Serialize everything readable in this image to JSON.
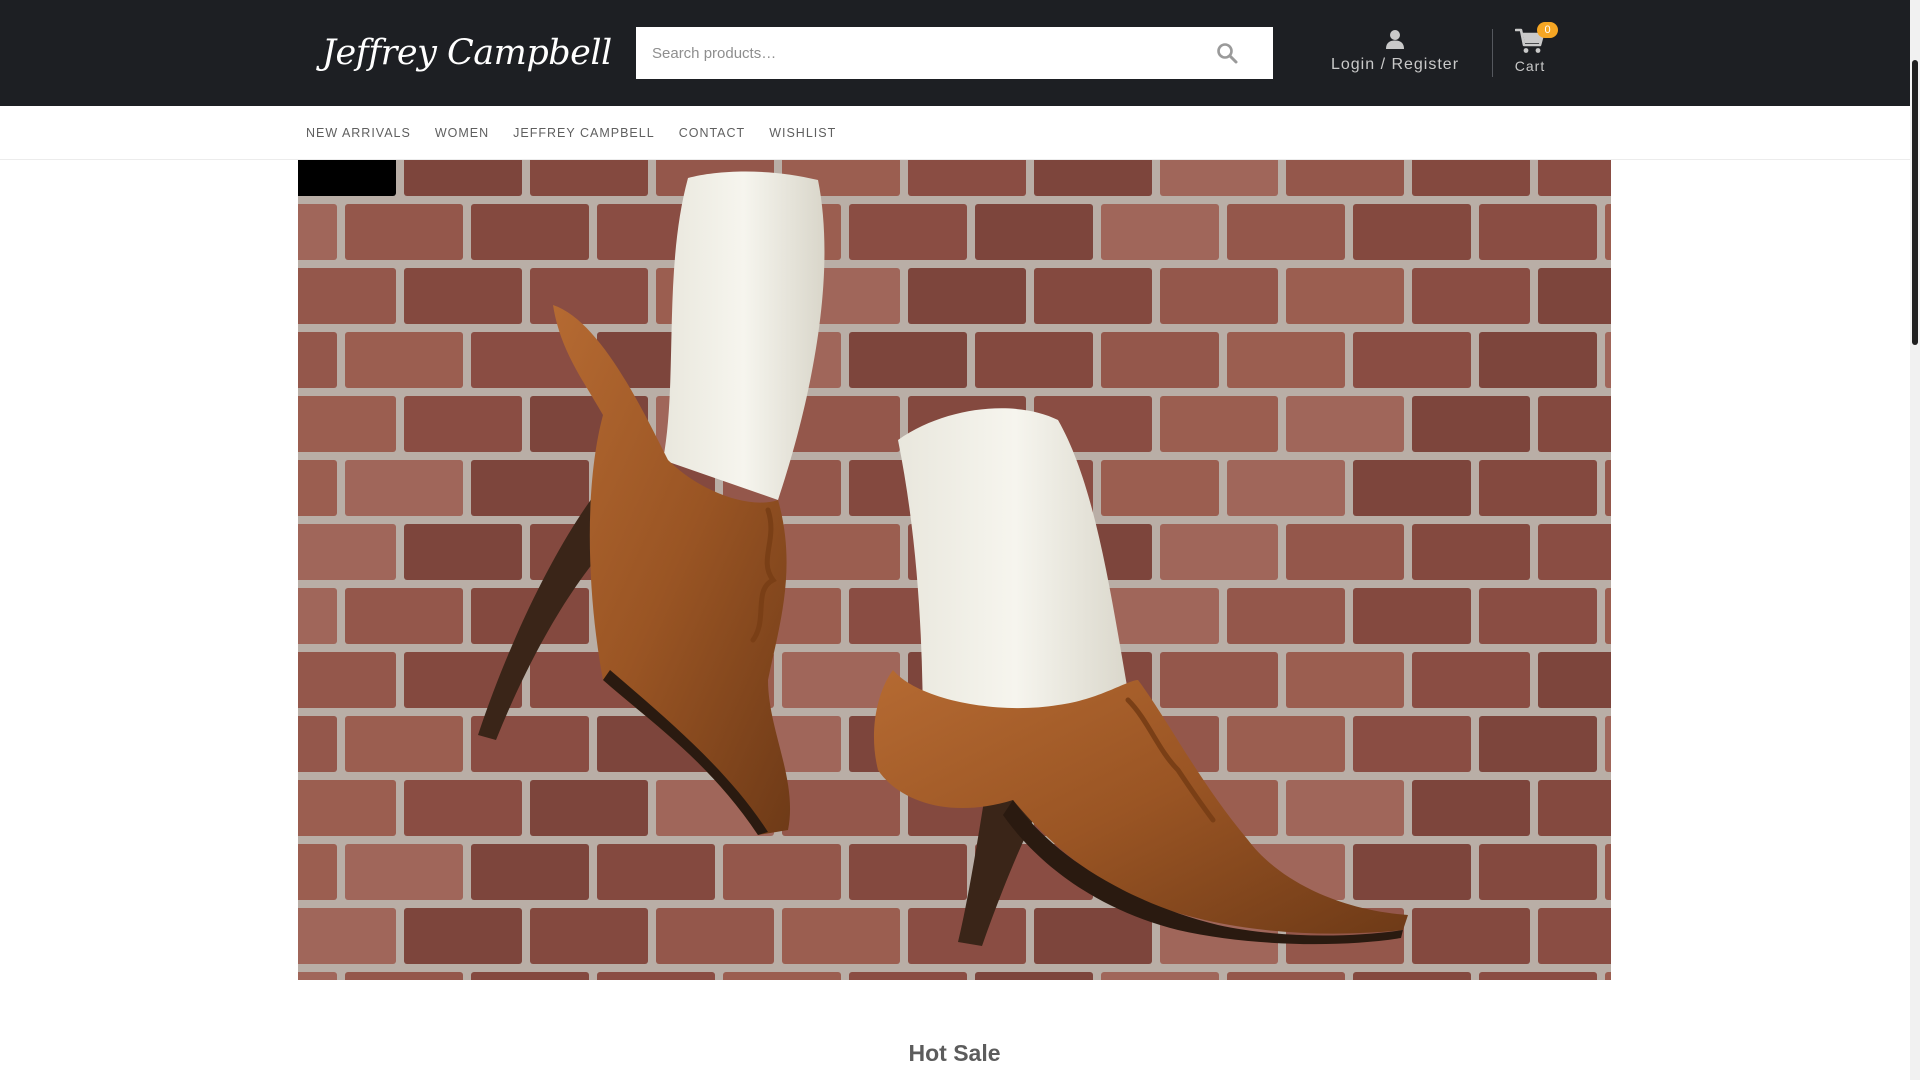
{
  "brand": {
    "logo_text": "Jeffrey Campbell"
  },
  "search": {
    "placeholder": "Search products…",
    "icon": "search-icon"
  },
  "account": {
    "label": "Login / Register",
    "icon": "user-icon"
  },
  "cart": {
    "label": "Cart",
    "count": "0",
    "icon": "cart-icon"
  },
  "nav": {
    "items": [
      {
        "label": "NEW ARRIVALS"
      },
      {
        "label": "WOMEN"
      },
      {
        "label": "JEFFREY CAMPBELL"
      },
      {
        "label": "CONTACT"
      },
      {
        "label": "WISHLIST"
      }
    ]
  },
  "hero": {
    "image": "brown-pointed-heels-white-socks-on-brick"
  },
  "sections": {
    "hot_sale_title": "Hot Sale"
  },
  "colors": {
    "header_bg": "#1d1f23",
    "badge": "#f6a623",
    "header_text": "#c9c9c9",
    "nav_text": "#5f5f5f",
    "brick": "#8a4d43",
    "leather": "#9a5524"
  }
}
